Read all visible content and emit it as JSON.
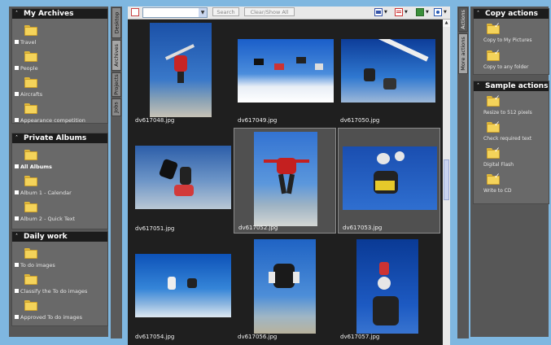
{
  "toolbar": {
    "search_value": "",
    "search_label": "Search",
    "clear_label": "Clear/Show All"
  },
  "left_tabs": [
    "Desktop",
    "Archives",
    "Projects",
    "Jobs"
  ],
  "right_tabs": [
    "Actions",
    "More actions"
  ],
  "sections": {
    "archives": {
      "title": "My Archives",
      "items": [
        "Travel",
        "People",
        "Aircrafts",
        "Appearance competition"
      ]
    },
    "albums": {
      "title": "Private Albums",
      "items": [
        "All Albums",
        "Album 1 - Calendar",
        "Album 2 - Quick Text"
      ]
    },
    "work": {
      "title": "Daily work",
      "items": [
        "To do images",
        "Classify the To do images",
        "Approved To do images"
      ]
    }
  },
  "actions": {
    "copy": {
      "title": "Copy actions",
      "items": [
        "Copy to My Pictures",
        "Copy to any folder"
      ]
    },
    "sample": {
      "title": "Sample actions",
      "items": [
        "Resize to 512 pixels",
        "Check required text",
        "Digital Flash",
        "Write to CD"
      ]
    }
  },
  "photos": [
    {
      "name": "dv617048.jpg",
      "selected": false
    },
    {
      "name": "dv617049.jpg",
      "selected": false
    },
    {
      "name": "dv617050.jpg",
      "selected": false
    },
    {
      "name": "dv617051.jpg",
      "selected": false
    },
    {
      "name": "dv617052.jpg",
      "selected": true
    },
    {
      "name": "dv617053.jpg",
      "selected": true
    },
    {
      "name": "dv617054.jpg",
      "selected": false
    },
    {
      "name": "dv617056.jpg",
      "selected": false
    },
    {
      "name": "dv617057.jpg",
      "selected": false
    }
  ],
  "colors": {
    "background": "#7fb7e0",
    "panel": "#575757",
    "section_header": "#1c1c1c",
    "folder": "#f4d35a",
    "grid": "#1f1f1f",
    "selection": "#505050",
    "sky": "#2a66c4"
  }
}
